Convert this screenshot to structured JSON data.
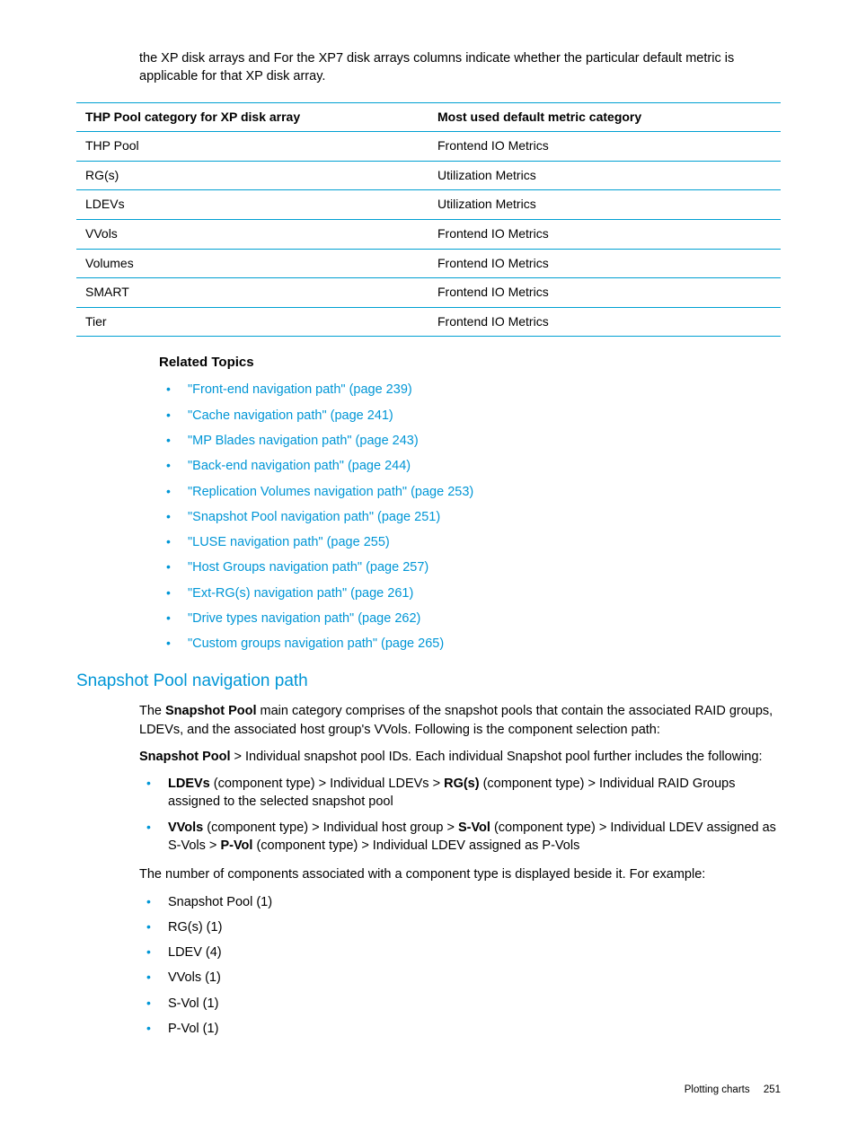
{
  "intro": "the XP disk arrays and For the XP7 disk arrays columns indicate whether the particular default metric is applicable for that XP disk array.",
  "table": {
    "headers": [
      "THP Pool category for XP disk array",
      "Most used default metric category"
    ],
    "rows": [
      [
        "THP Pool",
        "Frontend IO Metrics"
      ],
      [
        "RG(s)",
        "Utilization Metrics"
      ],
      [
        "LDEVs",
        "Utilization Metrics"
      ],
      [
        "VVols",
        "Frontend IO Metrics"
      ],
      [
        "Volumes",
        "Frontend IO Metrics"
      ],
      [
        "SMART",
        "Frontend IO Metrics"
      ],
      [
        "Tier",
        "Frontend IO Metrics"
      ]
    ]
  },
  "related": {
    "heading": "Related Topics",
    "items": [
      "\"Front-end navigation path\" (page 239)",
      "\"Cache navigation path\" (page 241)",
      "\"MP Blades navigation path\" (page 243)",
      "\"Back-end navigation path\" (page 244)",
      "\"Replication Volumes navigation path\" (page 253)",
      "\"Snapshot Pool navigation path\" (page 251)",
      "\"LUSE navigation path\" (page 255)",
      "\"Host Groups navigation path\" (page 257)",
      "\"Ext-RG(s) navigation path\" (page 261)",
      "\"Drive types navigation path\" (page 262)",
      "\"Custom groups navigation path\" (page 265)"
    ]
  },
  "section": {
    "title": "Snapshot Pool navigation path",
    "p1_pre": "The ",
    "p1_b": "Snapshot Pool",
    "p1_post": " main category comprises of the snapshot pools that contain the associated RAID groups, LDEVs, and the associated host group's VVols. Following is the component selection path:",
    "p2_b": "Snapshot Pool",
    "p2_post": " > Individual snapshot pool IDs. Each individual Snapshot pool further includes the following:",
    "list1": {
      "i1_b1": "LDEVs",
      "i1_t1": " (component type) > Individual LDEVs > ",
      "i1_b2": "RG(s)",
      "i1_t2": " (component type) > Individual RAID Groups assigned to the selected snapshot pool",
      "i2_b1": "VVols",
      "i2_t1": " (component type) > Individual host group > ",
      "i2_b2": "S-Vol",
      "i2_t2": " (component type) > Individual LDEV assigned as S-Vols > ",
      "i2_b3": "P-Vol",
      "i2_t3": " (component type) > Individual LDEV assigned as P-Vols"
    },
    "p3": "The number of components associated with a component type is displayed beside it. For example:",
    "list2": [
      "Snapshot Pool (1)",
      "RG(s) (1)",
      "LDEV (4)",
      "VVols (1)",
      "S-Vol (1)",
      "P-Vol (1)"
    ]
  },
  "footer": {
    "label": "Plotting charts",
    "page": "251"
  }
}
